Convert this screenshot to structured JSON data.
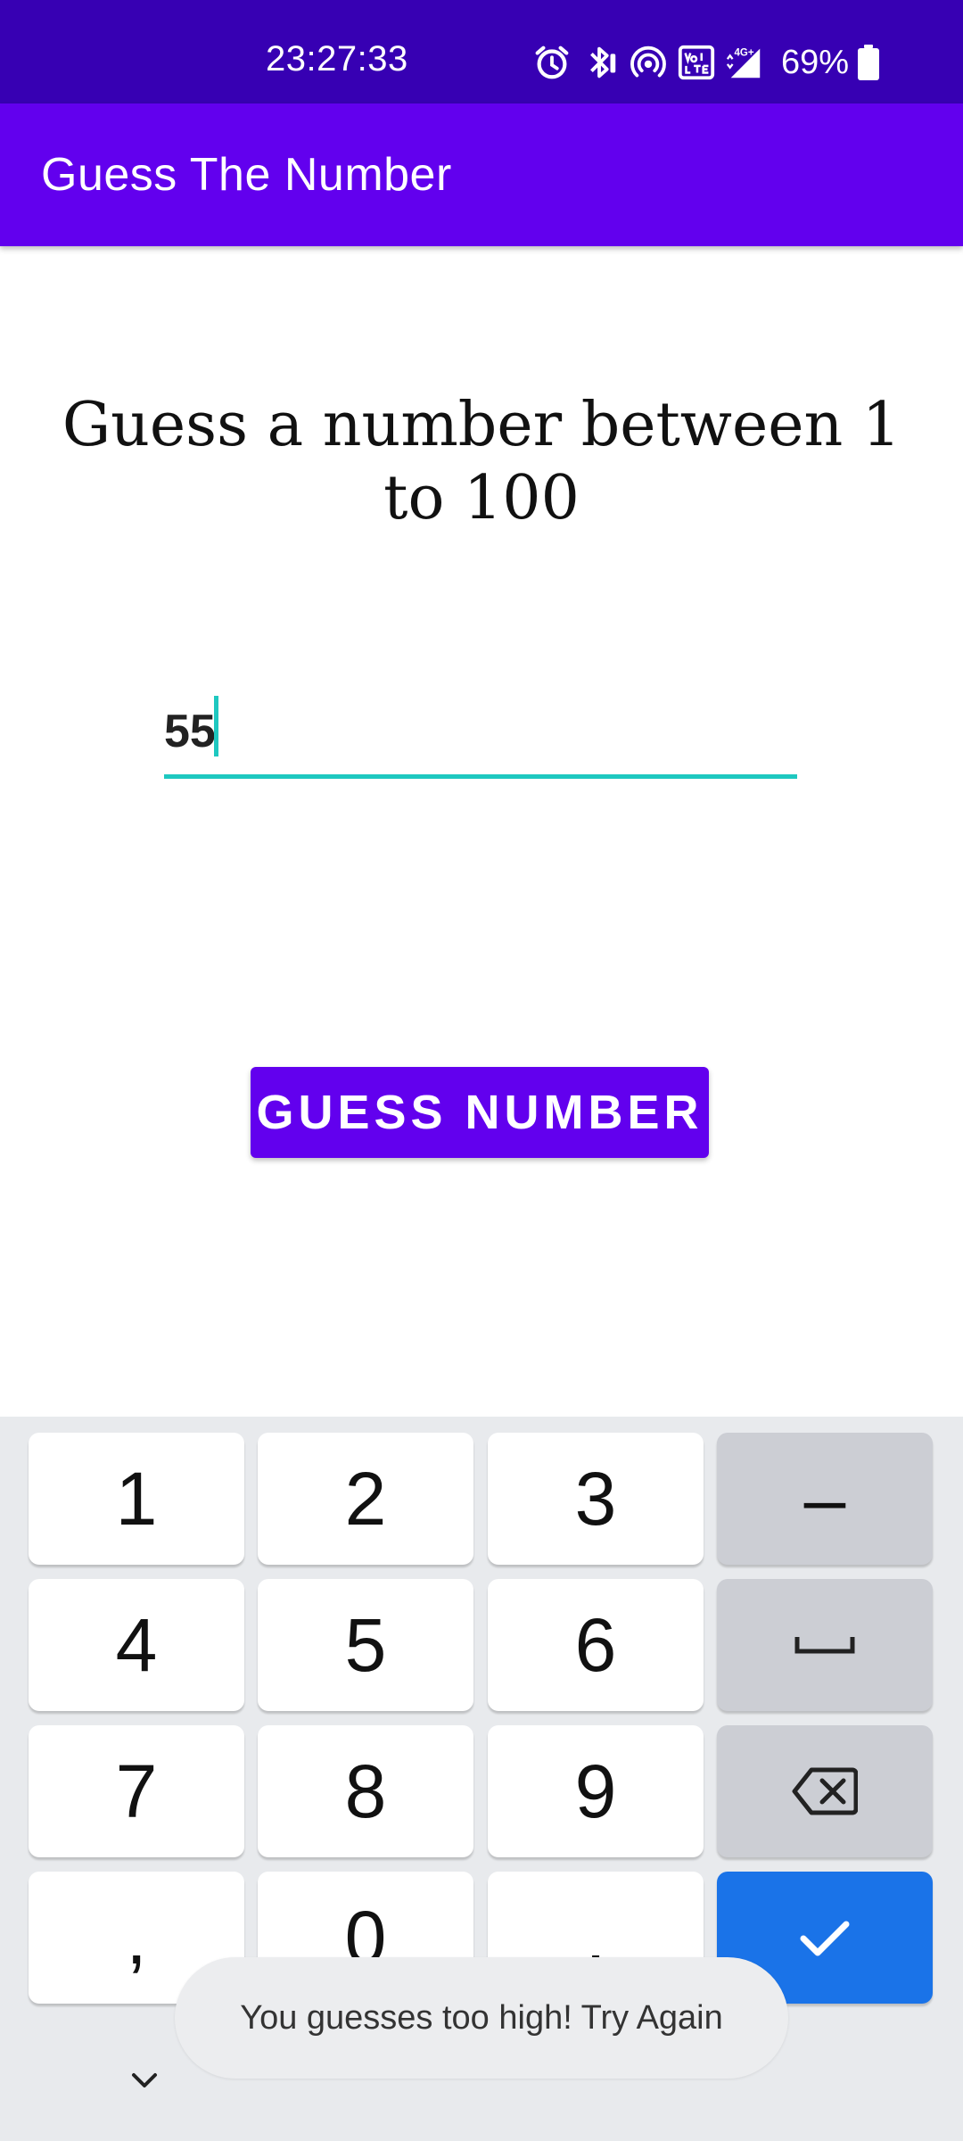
{
  "status_bar": {
    "time": "23:27:33",
    "battery_percent": "69%",
    "icons": [
      "alarm-icon",
      "bluetooth-icon",
      "hotspot-icon",
      "volte-icon",
      "signal-4g-icon",
      "battery-icon"
    ],
    "background_color": "#3700b3"
  },
  "app_bar": {
    "title": "Guess The Number",
    "background_color": "#6200ee"
  },
  "main": {
    "prompt": "Guess a number between 1 to 100",
    "input_value": "55",
    "accent_color": "#1ec8c0",
    "button_label": "GUESS NUMBER"
  },
  "keyboard": {
    "rows": [
      [
        "1",
        "2",
        "3",
        "–"
      ],
      [
        "4",
        "5",
        "6",
        "space"
      ],
      [
        "7",
        "8",
        "9",
        "backspace"
      ],
      [
        ",",
        "0",
        ".",
        "done"
      ]
    ],
    "keys": {
      "k1": "1",
      "k2": "2",
      "k3": "3",
      "minus": "–",
      "k4": "4",
      "k5": "5",
      "k6": "6",
      "k7": "7",
      "k8": "8",
      "k9": "9",
      "comma": ",",
      "k0": "0",
      "period": "."
    },
    "done_color": "#1a73e8"
  },
  "toast": {
    "message": "You guesses too high! Try Again"
  }
}
